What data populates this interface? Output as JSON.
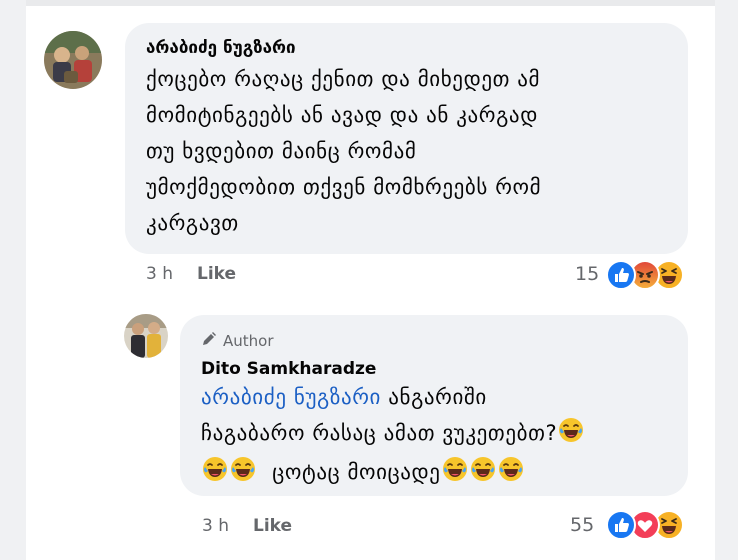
{
  "comment": {
    "author": "არაბიძე ნუგზარი",
    "lines": [
      "ქოცებო რაღაც ქენით და მიხედეთ ამ",
      "მომიტინგეებს ან ავად და ან კარგად",
      "თუ ხვდებით მაინც რომამ",
      "უმოქმედობით თქვენ მომხრეებს რომ",
      "კარგავთ"
    ],
    "time": "3 h",
    "like_label": "Like",
    "reaction_count": "15",
    "reactions": [
      "like-icon",
      "angry-icon",
      "haha-icon"
    ]
  },
  "reply": {
    "badge_label": "Author",
    "badge_icon": "pencil-icon",
    "author": "Dito Samkharadze",
    "mention": "არაბიძე ნუგზარი",
    "line1_rest": "ანგარიში",
    "line2": "ჩაგაბარო რასაც ამათ ვუკეთებთ?",
    "line3": "ცოტაც მოიცადე",
    "emoji": "laughing-tears-emoji",
    "time": "3 h",
    "like_label": "Like",
    "reaction_count": "55",
    "reactions": [
      "like-icon",
      "love-icon",
      "haha-icon"
    ]
  },
  "colors": {
    "bubble": "#f0f2f5",
    "meta_text": "#65676b",
    "mention": "#1b5fc4",
    "like_blue": "#1877f2",
    "angry": "#e9710f",
    "love": "#f33e58",
    "haha": "#f7b125"
  }
}
